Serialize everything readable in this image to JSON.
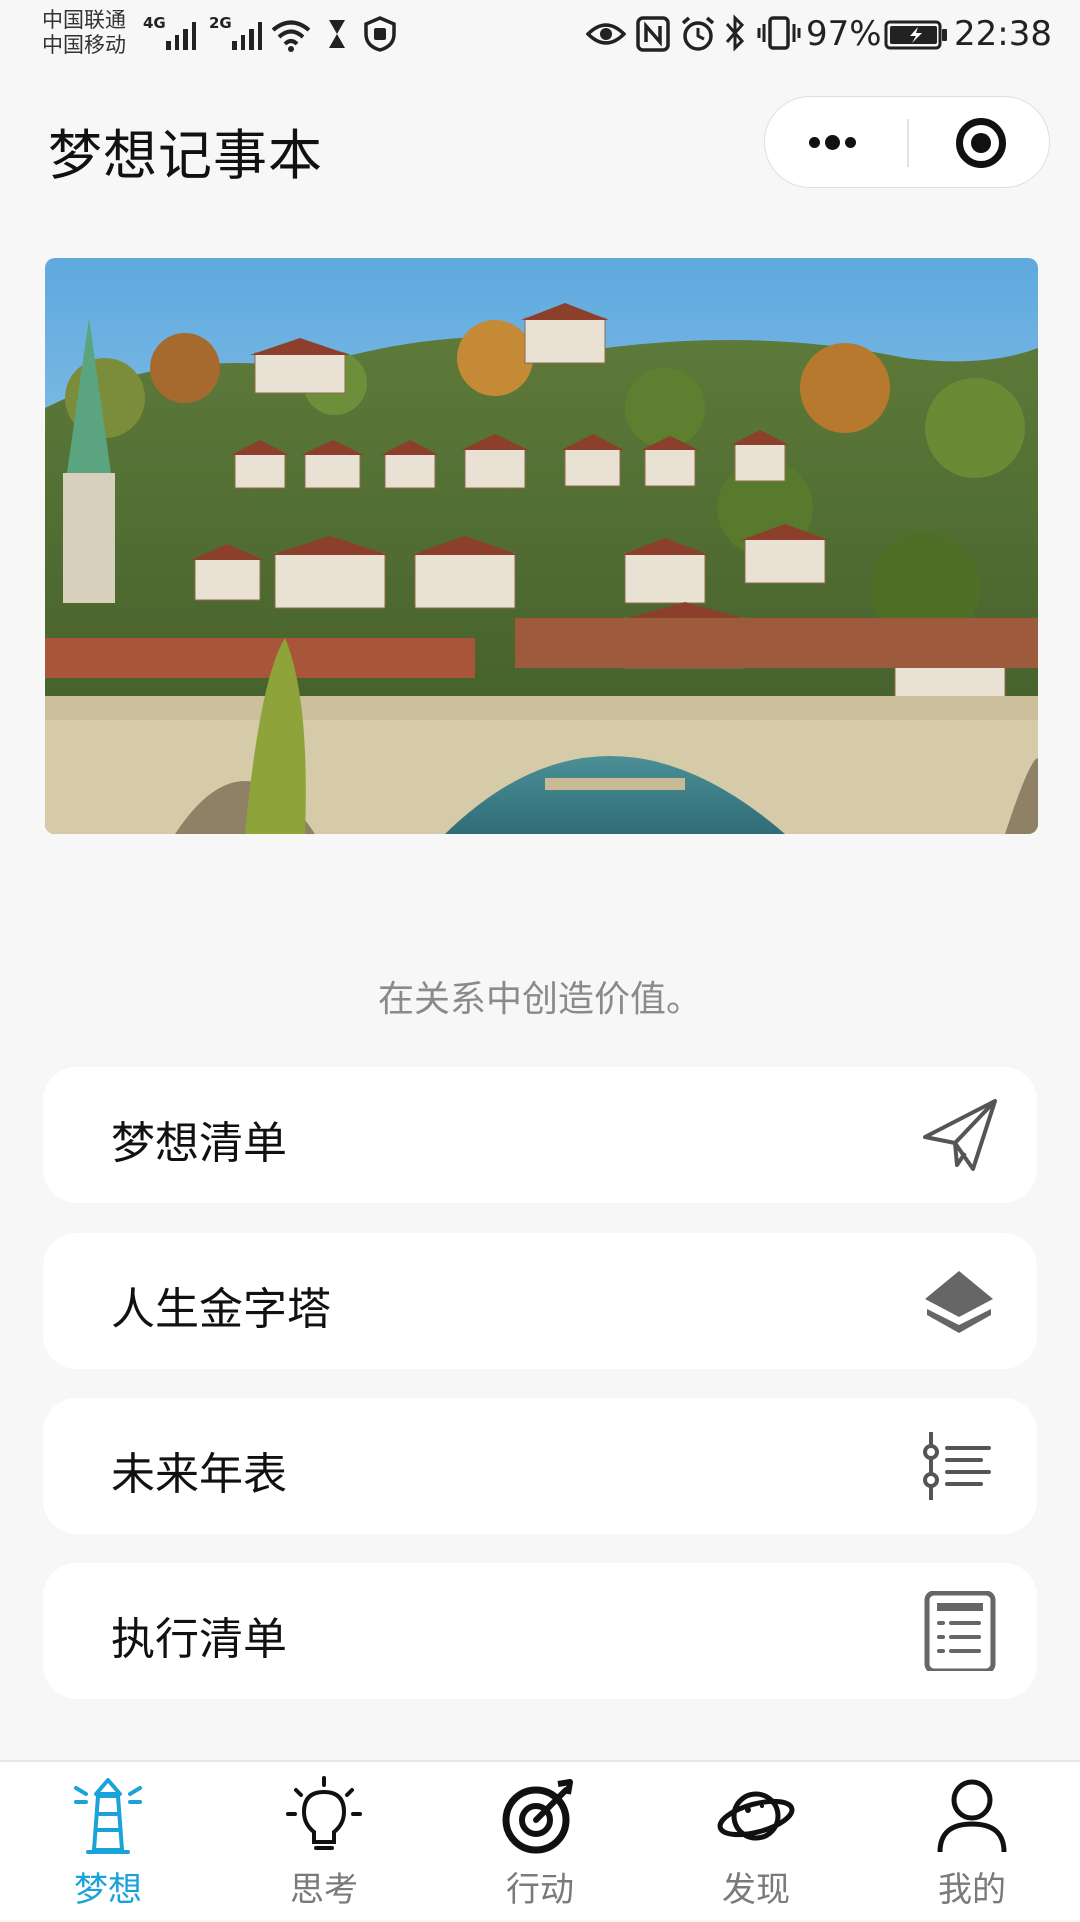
{
  "status_bar": {
    "carrier_1": "中国联通",
    "carrier_2": "中国移动",
    "net_1": "4G",
    "net_2": "2G",
    "battery": "97%",
    "time": "22:38"
  },
  "header": {
    "title": "梦想记事本"
  },
  "banner": {
    "image": "bern-old-town-bridge-photo"
  },
  "slogan": "在关系中创造价值。",
  "menu": [
    {
      "label": "梦想清单",
      "icon": "paper-plane-icon"
    },
    {
      "label": "人生金字塔",
      "icon": "layers-icon"
    },
    {
      "label": "未来年表",
      "icon": "timeline-list-icon"
    },
    {
      "label": "执行清单",
      "icon": "checklist-icon"
    }
  ],
  "tabs": [
    {
      "label": "梦想",
      "icon": "lighthouse-icon",
      "active": true
    },
    {
      "label": "思考",
      "icon": "lightbulb-icon",
      "active": false
    },
    {
      "label": "行动",
      "icon": "target-icon",
      "active": false
    },
    {
      "label": "发现",
      "icon": "planet-icon",
      "active": false
    },
    {
      "label": "我的",
      "icon": "user-icon",
      "active": false
    }
  ],
  "colors": {
    "background": "#f7f7f7",
    "card": "#ffffff",
    "accent": "#1aa3d9",
    "tab_inactive": "#7a7a7a",
    "slogan": "#8a8a8a"
  }
}
